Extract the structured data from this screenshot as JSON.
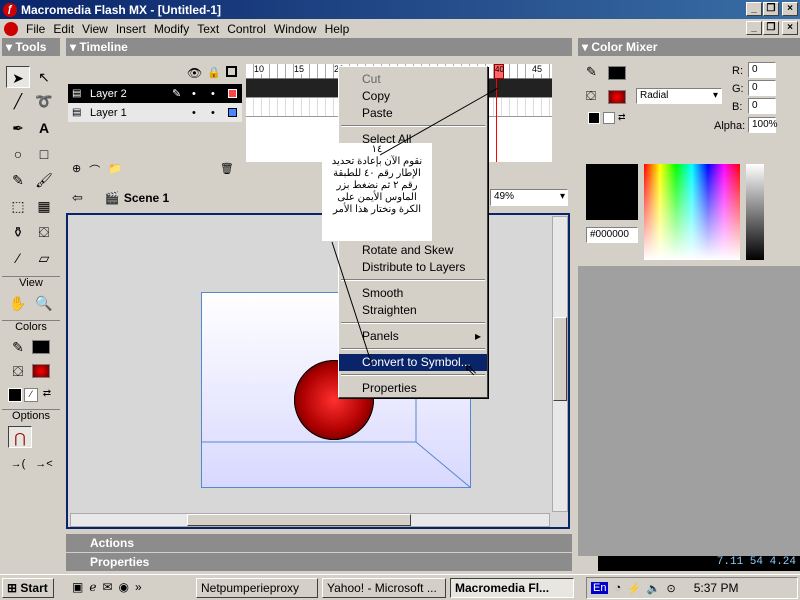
{
  "window": {
    "title": "Macromedia Flash MX - [Untitled-1]"
  },
  "menu": [
    "File",
    "Edit",
    "View",
    "Insert",
    "Modify",
    "Text",
    "Control",
    "Window",
    "Help"
  ],
  "toolbox": {
    "title": "Tools",
    "view_label": "View",
    "colors_label": "Colors",
    "options_label": "Options"
  },
  "timeline": {
    "title": "Timeline",
    "ruler": [
      "10",
      "15",
      "20",
      "40",
      "45"
    ],
    "layers": [
      {
        "name": "Layer 2"
      },
      {
        "name": "Layer 1"
      }
    ],
    "zoom": "49%",
    "frame": "40"
  },
  "scene": {
    "label": "Scene 1"
  },
  "context_menu": {
    "items": [
      "Cut",
      "Copy",
      "Paste",
      "Select All",
      "Rotate and Skew",
      "Distribute to Layers",
      "Smooth",
      "Straighten",
      "Panels",
      "Convert to Symbol...",
      "Properties"
    ],
    "highlighted": "Convert to Symbol..."
  },
  "annotation": {
    "lines": [
      "١٤",
      "نقوم الآن بإعادة تحديد",
      "الإطار رقم ٤٠ للطبقة",
      "رقم ٢ ثم نضغط بزر",
      "الماوس الأيمن على",
      "الكرة ونختار هذا الأمر"
    ]
  },
  "color_mixer": {
    "title": "Color Mixer",
    "r_label": "R:",
    "r": "0",
    "g_label": "G:",
    "g": "0",
    "b_label": "B:",
    "b": "0",
    "alpha_label": "Alpha:",
    "alpha": "100%",
    "fill_type": "Radial",
    "hex": "#000000"
  },
  "panels": {
    "actions": "Actions",
    "properties": "Properties"
  },
  "status": {
    "coords": "7.11  54  4.24"
  },
  "taskbar": {
    "start": "Start",
    "tasks": [
      "Netpumperieproxy",
      "Yahoo! - Microsoft ...",
      "Macromedia Fl..."
    ],
    "lang": "En",
    "clock": "5:37 PM"
  },
  "colors": {
    "title_start": "#0a246a",
    "highlight": "#0a246a",
    "ball": "#cc0000"
  }
}
